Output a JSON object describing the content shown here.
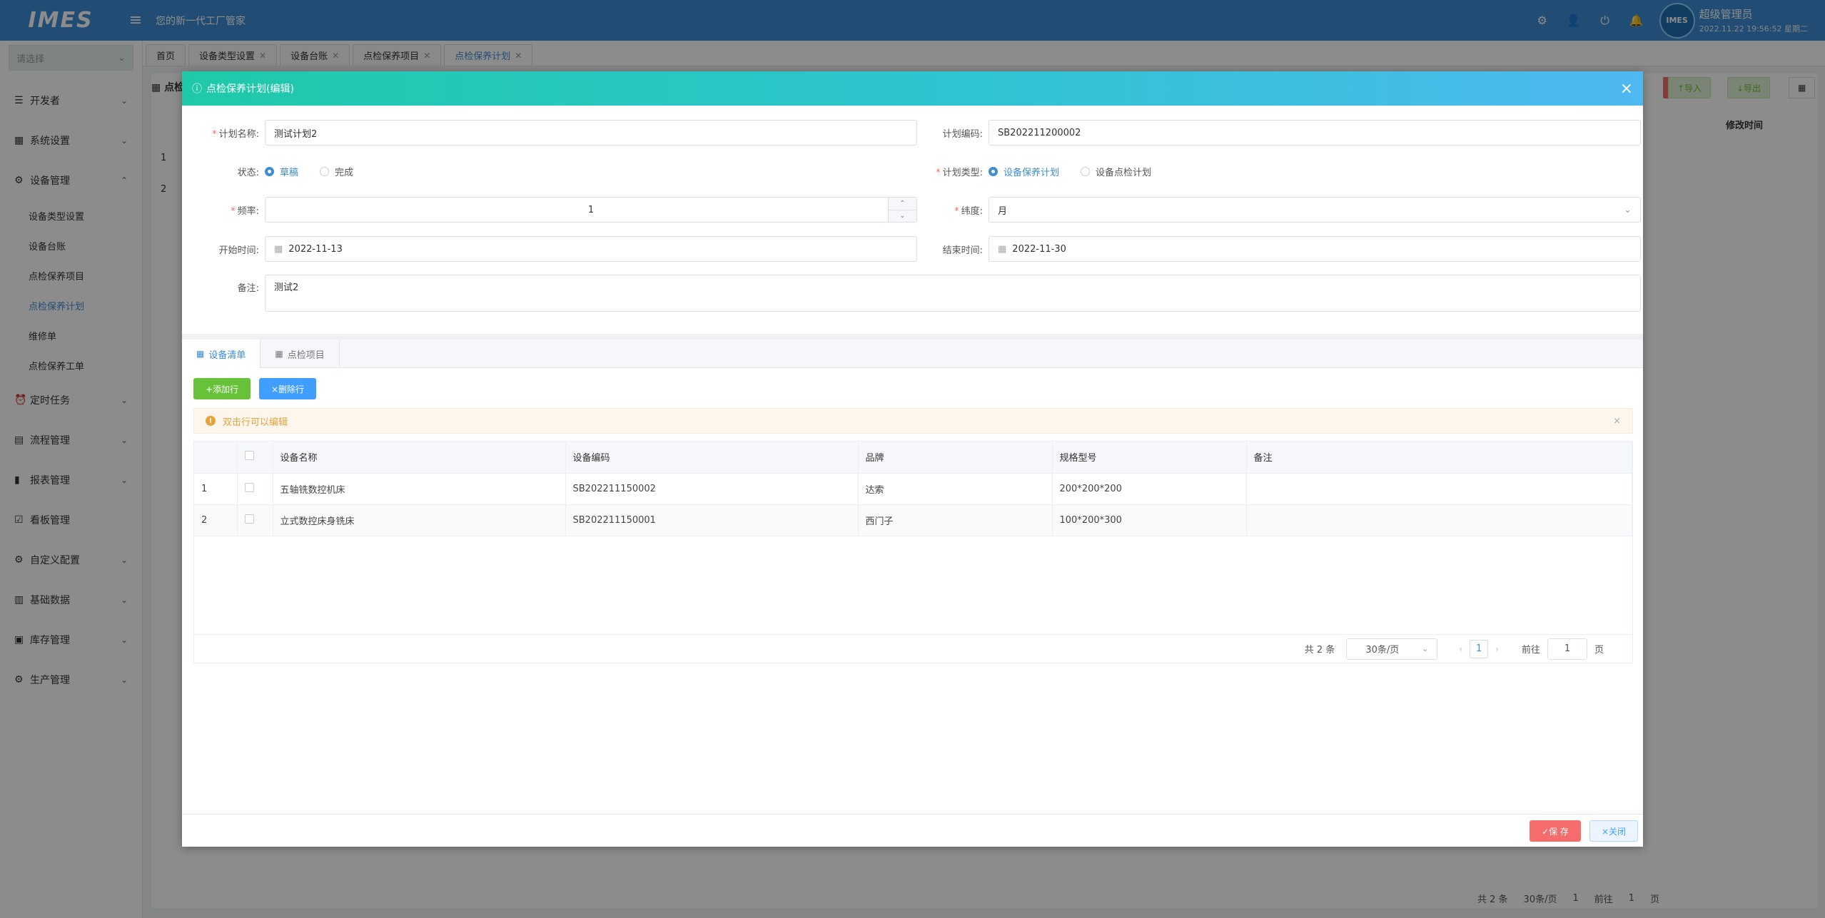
{
  "topbar": {
    "logo": "IMES",
    "slogan": "您的新一代工厂管家",
    "user_name": "超级管理员",
    "datetime": "2022.11.22 19:56:52 星期二",
    "avatar_text": "IMES"
  },
  "sidebar": {
    "select_placeholder": "请选择",
    "items": [
      {
        "label": "开发者",
        "icon": "sliders-icon"
      },
      {
        "label": "系统设置",
        "icon": "grid-icon"
      },
      {
        "label": "设备管理",
        "icon": "gear-icon"
      },
      {
        "label": "定时任务",
        "icon": "clock-icon"
      },
      {
        "label": "流程管理",
        "icon": "flow-icon"
      },
      {
        "label": "报表管理",
        "icon": "bar-chart-icon"
      },
      {
        "label": "看板管理",
        "icon": "board-icon"
      },
      {
        "label": "自定义配置",
        "icon": "cog-icon"
      },
      {
        "label": "基础数据",
        "icon": "book-icon"
      },
      {
        "label": "库存管理",
        "icon": "warehouse-icon"
      },
      {
        "label": "生产管理",
        "icon": "factory-icon"
      }
    ],
    "sub_items": [
      "设备类型设置",
      "设备台账",
      "点检保养项目",
      "点检保养计划",
      "维修单",
      "点检保养工单"
    ]
  },
  "tabs": [
    "首页",
    "设备类型设置",
    "设备台账",
    "点检保养项目",
    "点检保养计划"
  ],
  "background": {
    "title": "点检",
    "import_label": "↑导入",
    "export_label": "↓导出",
    "col_modified": "修改时间",
    "row1": "1",
    "row2": "2",
    "total": "共 2 条",
    "page_size": "30条/页",
    "page": "1",
    "goto": "前往",
    "goto_value": "1",
    "page_unit": "页"
  },
  "dialog": {
    "title": "点检保养计划(编辑)",
    "form": {
      "plan_name_label": "计划名称:",
      "plan_name": "测试计划2",
      "plan_code_label": "计划编码:",
      "plan_code": "SB202211200002",
      "status_label": "状态:",
      "status_options": [
        "草稿",
        "完成"
      ],
      "plan_type_label": "计划类型:",
      "plan_type_options": [
        "设备保养计划",
        "设备点检计划"
      ],
      "freq_label": "频率:",
      "freq": "1",
      "dim_label": "纬度:",
      "dim": "月",
      "start_label": "开始时间:",
      "start": "2022-11-13",
      "end_label": "结束时间:",
      "end": "2022-11-30",
      "remark_label": "备注:",
      "remark": "测试2"
    },
    "subtabs": [
      "设备清单",
      "点检项目"
    ],
    "add_row": "+添加行",
    "del_row": "×删除行",
    "alert": "双击行可以编辑",
    "table": {
      "headers": [
        "设备名称",
        "设备编码",
        "品牌",
        "规格型号",
        "备注"
      ],
      "rows": [
        {
          "idx": "1",
          "name": "五轴铣数控机床",
          "code": "SB202211150002",
          "brand": "达索",
          "spec": "200*200*200",
          "remark": ""
        },
        {
          "idx": "2",
          "name": "立式数控床身铣床",
          "code": "SB202211150001",
          "brand": "西门子",
          "spec": "100*200*300",
          "remark": ""
        }
      ]
    },
    "pager": {
      "total": "共 2 条",
      "page_size": "30条/页",
      "page": "1",
      "goto": "前往",
      "goto_value": "1",
      "page_unit": "页"
    },
    "save": "✓保 存",
    "close": "×关闭"
  },
  "colors": {
    "topbar": "#3c8dd4",
    "dialog_header_start": "#1fc9a8",
    "dialog_header_end": "#4eb8f0",
    "save": "#f56c6c",
    "add": "#67c23a",
    "delete": "#409eff"
  }
}
